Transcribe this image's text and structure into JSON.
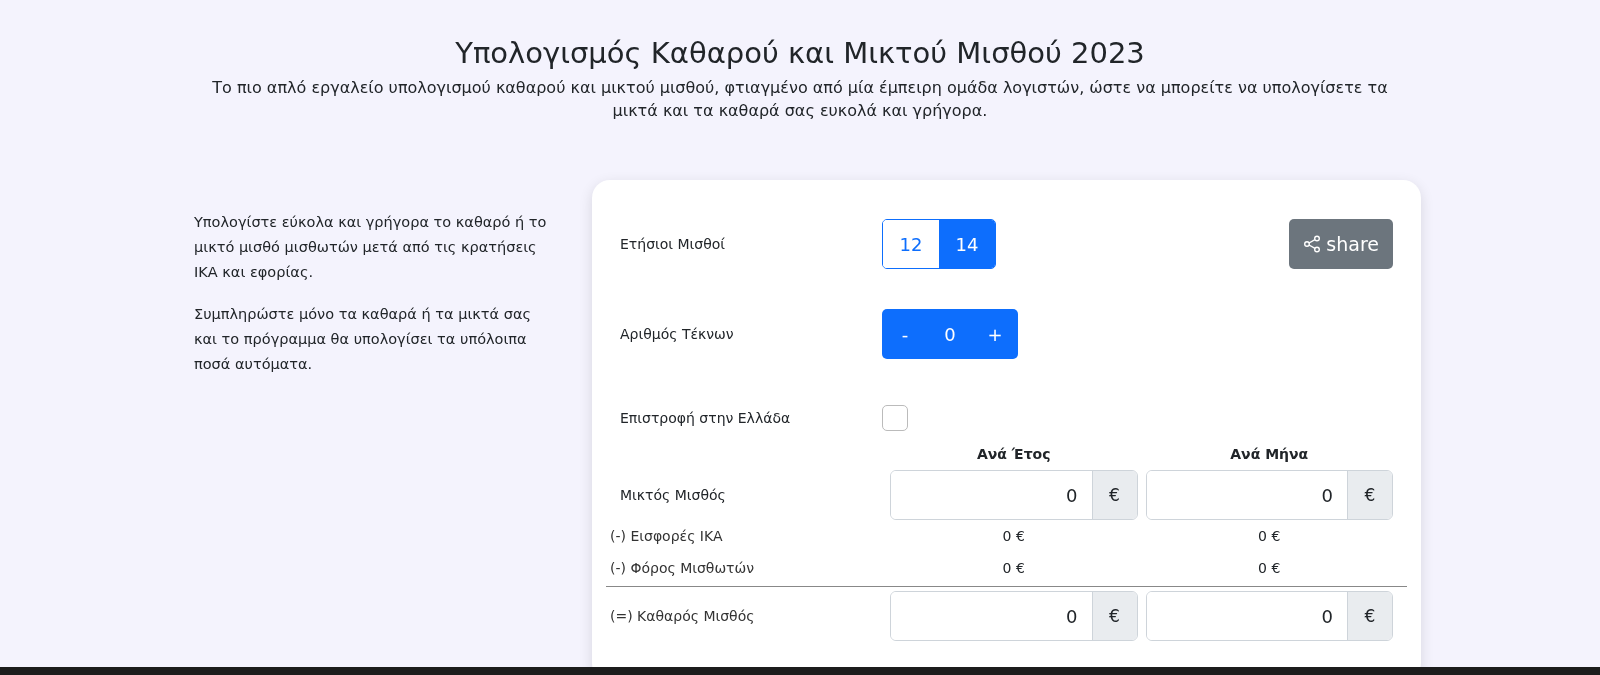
{
  "header": {
    "title": "Υπολογισμός Καθαρού και Μικτού Μισθού 2023",
    "subtitle": "Το πιο απλό εργαλείο υπολογισμού καθαρού και μικτού μισθού, φτιαγμένο από μία έμπειρη ομάδα λογιστών, ώστε να μπορείτε να υπολογίσετε τα μικτά και τα καθαρά σας ευκολά και γρήγορα."
  },
  "intro": [
    "Υπολογίστε εύκολα και γρήγορα το καθαρό ή το μικτό μισθό μισθωτών μετά από τις κρατήσεις ΙΚΑ και εφορίας.",
    "Συμπληρώστε μόνο τα καθαρά ή τα μικτά σας και το πρόγραμμα θα υπολογίσει τα υπόλοιπα ποσά αυτόματα."
  ],
  "form": {
    "salaries": {
      "label": "Ετήσιοι Μισθοί",
      "options": [
        {
          "label": "12",
          "selected": false
        },
        {
          "label": "14",
          "selected": true
        }
      ]
    },
    "share_button": {
      "label": "share"
    },
    "kids": {
      "label": "Αριθμός Τέκνων",
      "minus": "-",
      "value": "0",
      "plus": "+"
    },
    "return_to_greece": {
      "label": "Επιστροφή στην Ελλάδα",
      "checked": false
    },
    "columns": [
      "Ανά Έτος",
      "Ανά Μήνα"
    ],
    "rows": [
      {
        "kind": "input",
        "label": "Μικτός Μισθός",
        "values": [
          "0",
          "0"
        ],
        "unit": "€"
      },
      {
        "kind": "amount",
        "label": "(-) Εισφορές ΙΚΑ",
        "values": [
          "0 €",
          "0 €"
        ]
      },
      {
        "kind": "amount",
        "label": "(-) Φόρος Μισθωτών",
        "values": [
          "0 €",
          "0 €"
        ]
      },
      {
        "kind": "total",
        "label": "(=) Καθαρός Μισθός",
        "values": [
          "0",
          "0"
        ],
        "unit": "€"
      }
    ]
  }
}
